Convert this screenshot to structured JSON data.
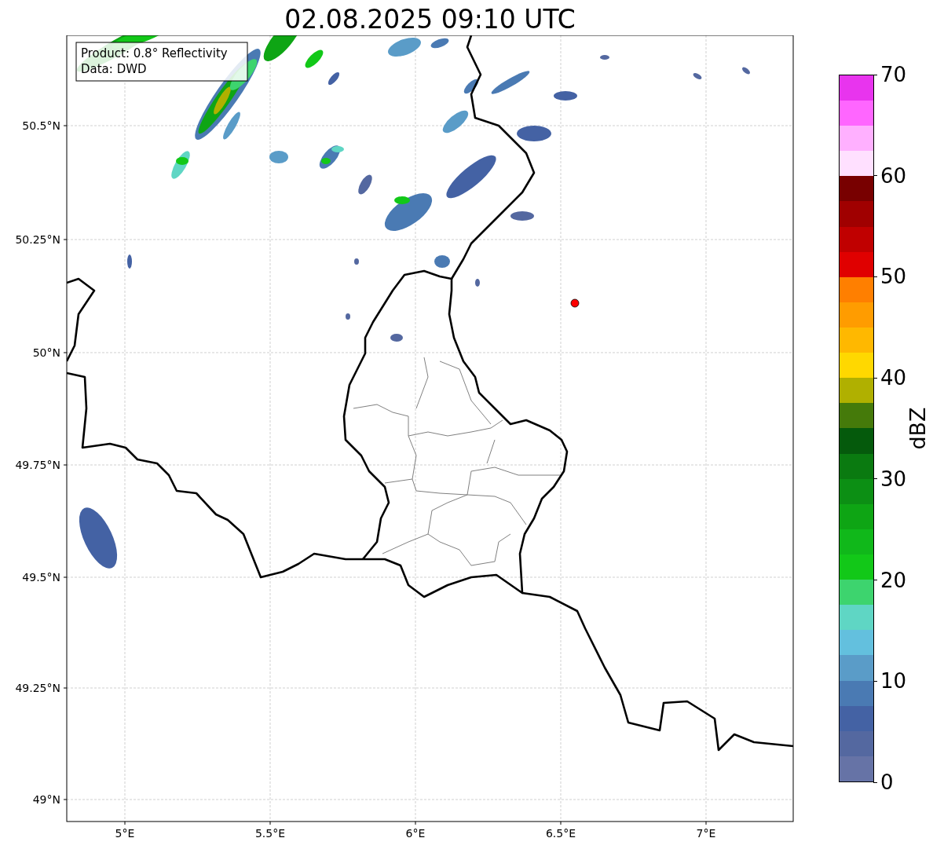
{
  "title": "02.08.2025 09:10 UTC",
  "map": {
    "info_lines": [
      "Product: 0.8° Reflectivity",
      "Data: DWD"
    ],
    "lat_ticks": [
      "50.5°N",
      "50.25°N",
      "50°N",
      "49.75°N",
      "49.5°N",
      "49.25°N",
      "49°N"
    ],
    "lon_ticks": [
      "5°E",
      "5.5°E",
      "6°E",
      "6.5°E",
      "7°E"
    ]
  },
  "colorbar": {
    "label": "dBZ",
    "ticks": [
      "70",
      "60",
      "50",
      "40",
      "30",
      "20",
      "10",
      "0"
    ],
    "bins": [
      {
        "color": "#6673a6"
      },
      {
        "color": "#5468a0"
      },
      {
        "color": "#4462a4"
      },
      {
        "color": "#4a7ab3"
      },
      {
        "color": "#5a9cc8"
      },
      {
        "color": "#63c0de"
      },
      {
        "color": "#5fd6c4"
      },
      {
        "color": "#3dd46e"
      },
      {
        "color": "#12c818"
      },
      {
        "color": "#10b81a"
      },
      {
        "color": "#0ea514"
      },
      {
        "color": "#0c8f14"
      },
      {
        "color": "#0a7a10"
      },
      {
        "color": "#055a0c"
      },
      {
        "color": "#457a0a"
      },
      {
        "color": "#b0b000"
      },
      {
        "color": "#ffd800"
      },
      {
        "color": "#ffb800"
      },
      {
        "color": "#ff9c00"
      },
      {
        "color": "#ff7f00"
      },
      {
        "color": "#e00000"
      },
      {
        "color": "#c00000"
      },
      {
        "color": "#a00000"
      },
      {
        "color": "#780000"
      },
      {
        "color": "#ffe0ff"
      },
      {
        "color": "#ffb0ff"
      },
      {
        "color": "#ff66ff"
      },
      {
        "color": "#e834ee"
      }
    ]
  }
}
